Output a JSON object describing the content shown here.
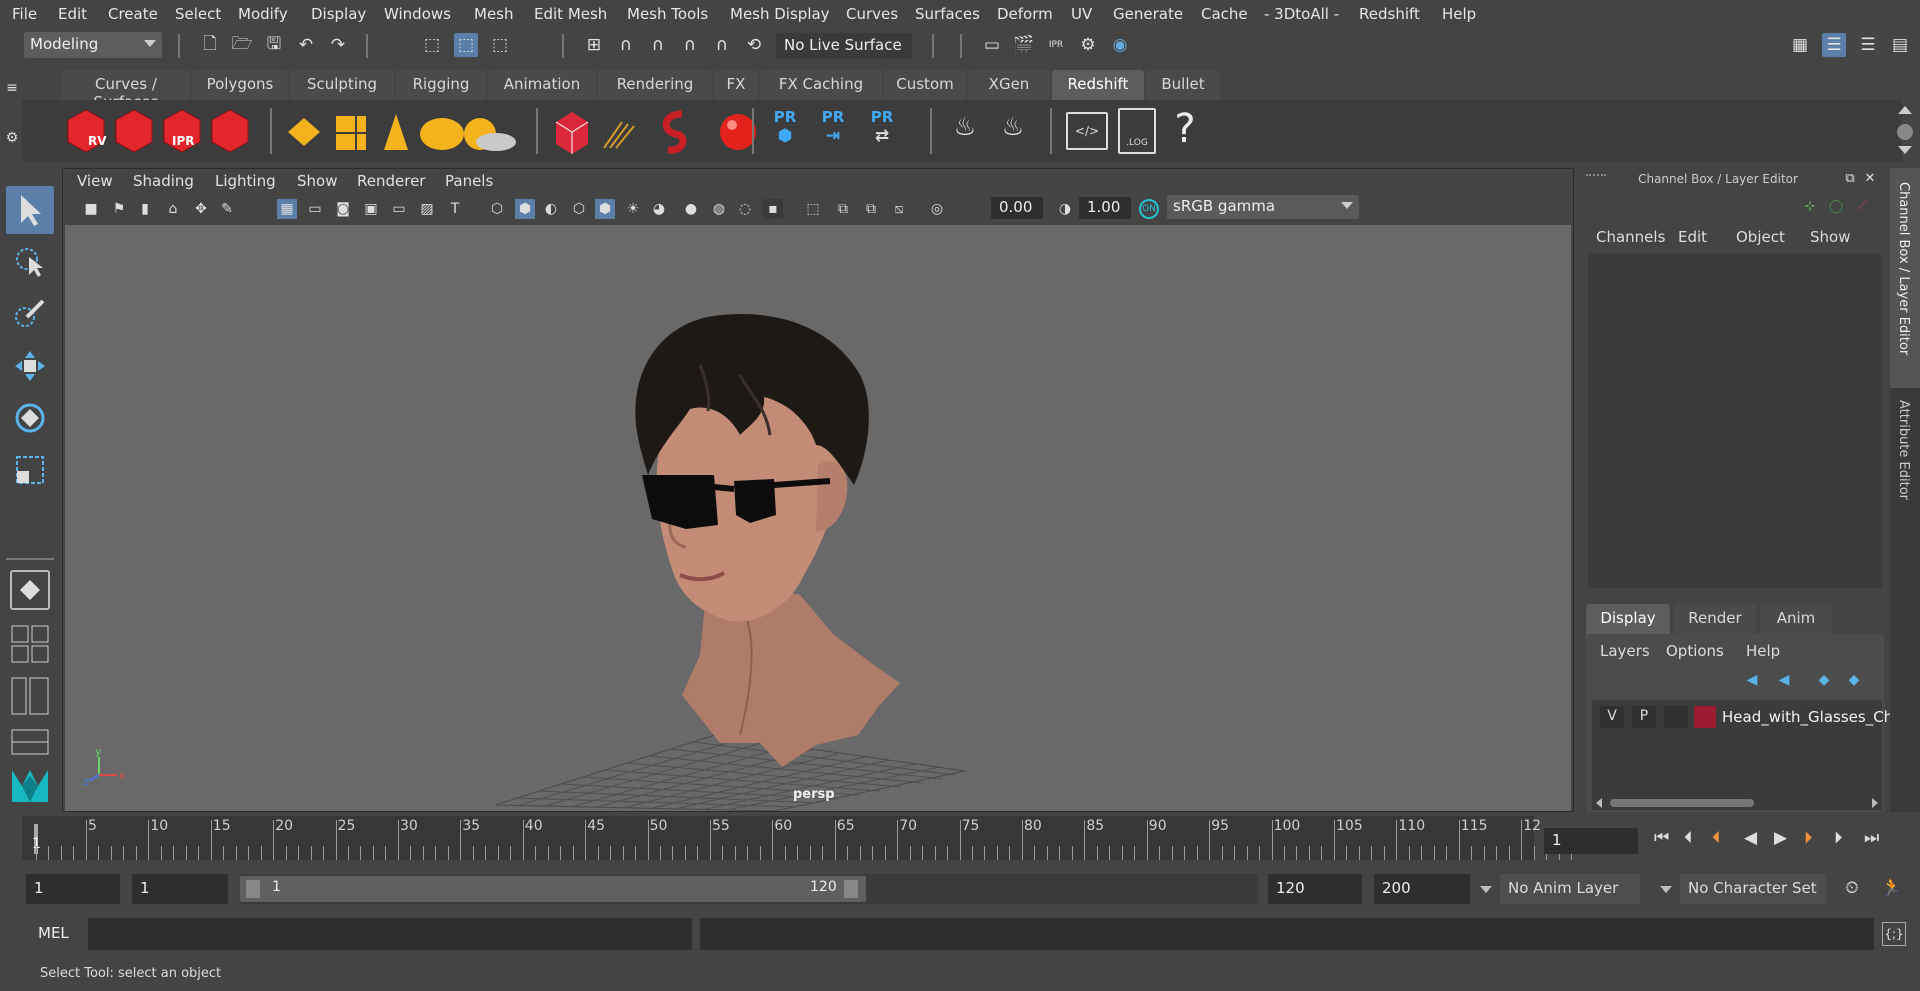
{
  "menu": [
    "File",
    "Edit",
    "Create",
    "Select",
    "Modify",
    "Display",
    "Windows",
    "Mesh",
    "Edit Mesh",
    "Mesh Tools",
    "Mesh Display",
    "Curves",
    "Surfaces",
    "Deform",
    "UV",
    "Generate",
    "Cache",
    "- 3DtoAll -",
    "Redshift",
    "Help"
  ],
  "status": {
    "workspace": "Modeling",
    "live_surface": "No Live Surface"
  },
  "shelf": {
    "tabs": [
      "Curves / Surfaces",
      "Polygons",
      "Sculpting",
      "Rigging",
      "Animation",
      "Rendering",
      "FX",
      "FX Caching",
      "Custom",
      "XGen",
      "Redshift",
      "Bullet"
    ],
    "active_tab": "Redshift",
    "icon_labels": {
      "rv": "RV",
      "ipr": "IPR",
      "pr": "PR",
      "log": ".LOG",
      "help": "?"
    }
  },
  "viewport": {
    "menu": [
      "View",
      "Shading",
      "Lighting",
      "Show",
      "Renderer",
      "Panels"
    ],
    "exposure": "0.00",
    "gamma": "1.00",
    "colorspace": "sRGB gamma",
    "camera_label": "persp",
    "axis_labels": {
      "x": "x",
      "y": "y",
      "z": "z"
    }
  },
  "channel_box": {
    "title": "Channel Box / Layer Editor",
    "menu": [
      "Channels",
      "Edit",
      "Object",
      "Show"
    ],
    "side_tabs": [
      "Channel Box / Layer Editor",
      "Attribute Editor"
    ]
  },
  "layer_editor": {
    "tabs": [
      "Display",
      "Render",
      "Anim"
    ],
    "active_tab": "Display",
    "menu": [
      "Layers",
      "Options",
      "Help"
    ],
    "layer": {
      "v": "V",
      "p": "P",
      "name": "Head_with_Glasses_Ch",
      "color": "#9b1b30"
    }
  },
  "timeline": {
    "ticks": [
      "5",
      "10",
      "15",
      "20",
      "25",
      "30",
      "35",
      "40",
      "45",
      "50",
      "55",
      "60",
      "65",
      "70",
      "75",
      "80",
      "85",
      "90",
      "95",
      "100",
      "105",
      "110",
      "115",
      "12"
    ],
    "start_label": "1",
    "current_frame": "1"
  },
  "range": {
    "start": "1",
    "playback_start": "1",
    "slider_start": "1",
    "slider_end": "120",
    "playback_end": "120",
    "end": "200",
    "anim_layer": "No Anim Layer",
    "character_set": "No Character Set"
  },
  "command": {
    "label": "MEL"
  },
  "help_line": "Select Tool: select an object"
}
